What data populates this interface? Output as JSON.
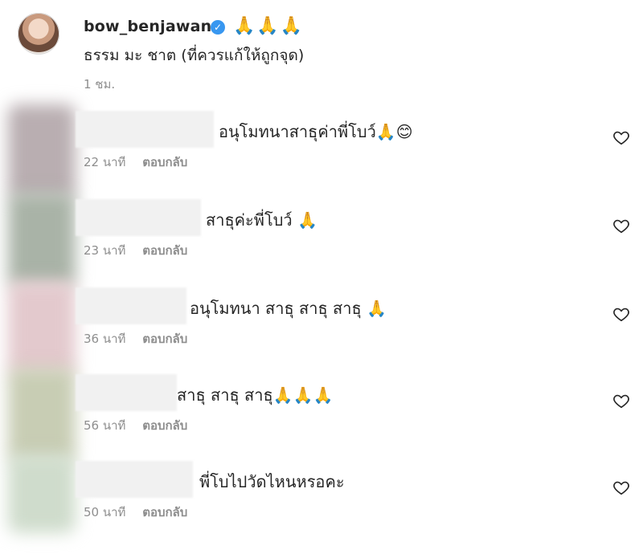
{
  "post": {
    "username": "bow_benjawan",
    "verified_icon": "verified-badge-icon",
    "header_emojis": "🙏🙏🙏",
    "caption": "ธรรม มะ ชาต (ที่ควรแก้ให้ถูกจุด)",
    "time": "1 ชม."
  },
  "comments": [
    {
      "text": "อนุโมทนาสาธุค่าพี่โบว์🙏😊",
      "time": "22 นาที",
      "reply_label": "ตอบกลับ",
      "avatar_color": "#b9aeb1"
    },
    {
      "text": "สาธุค่ะพี่โบว์ 🙏",
      "time": "23 นาที",
      "reply_label": "ตอบกลับ",
      "avatar_color": "#a9b3a7"
    },
    {
      "text": "อนุโมทนา สาธุ สาธุ สาธุ 🙏",
      "time": "36 นาที",
      "reply_label": "ตอบกลับ",
      "avatar_color": "#e3c9cd"
    },
    {
      "text": "สาธุ สาธุ สาธุ🙏🙏🙏",
      "time": "56 นาที",
      "reply_label": "ตอบกลับ",
      "avatar_color": "#c8cdb4"
    },
    {
      "text": "พี่โบไปวัดไหนหรอคะ",
      "time": "50 นาที",
      "reply_label": "ตอบกลับ",
      "avatar_color": "#cfdccc"
    }
  ],
  "colors": {
    "text": "#262626",
    "secondary": "#8e8e8e",
    "verified": "#3897f0"
  }
}
